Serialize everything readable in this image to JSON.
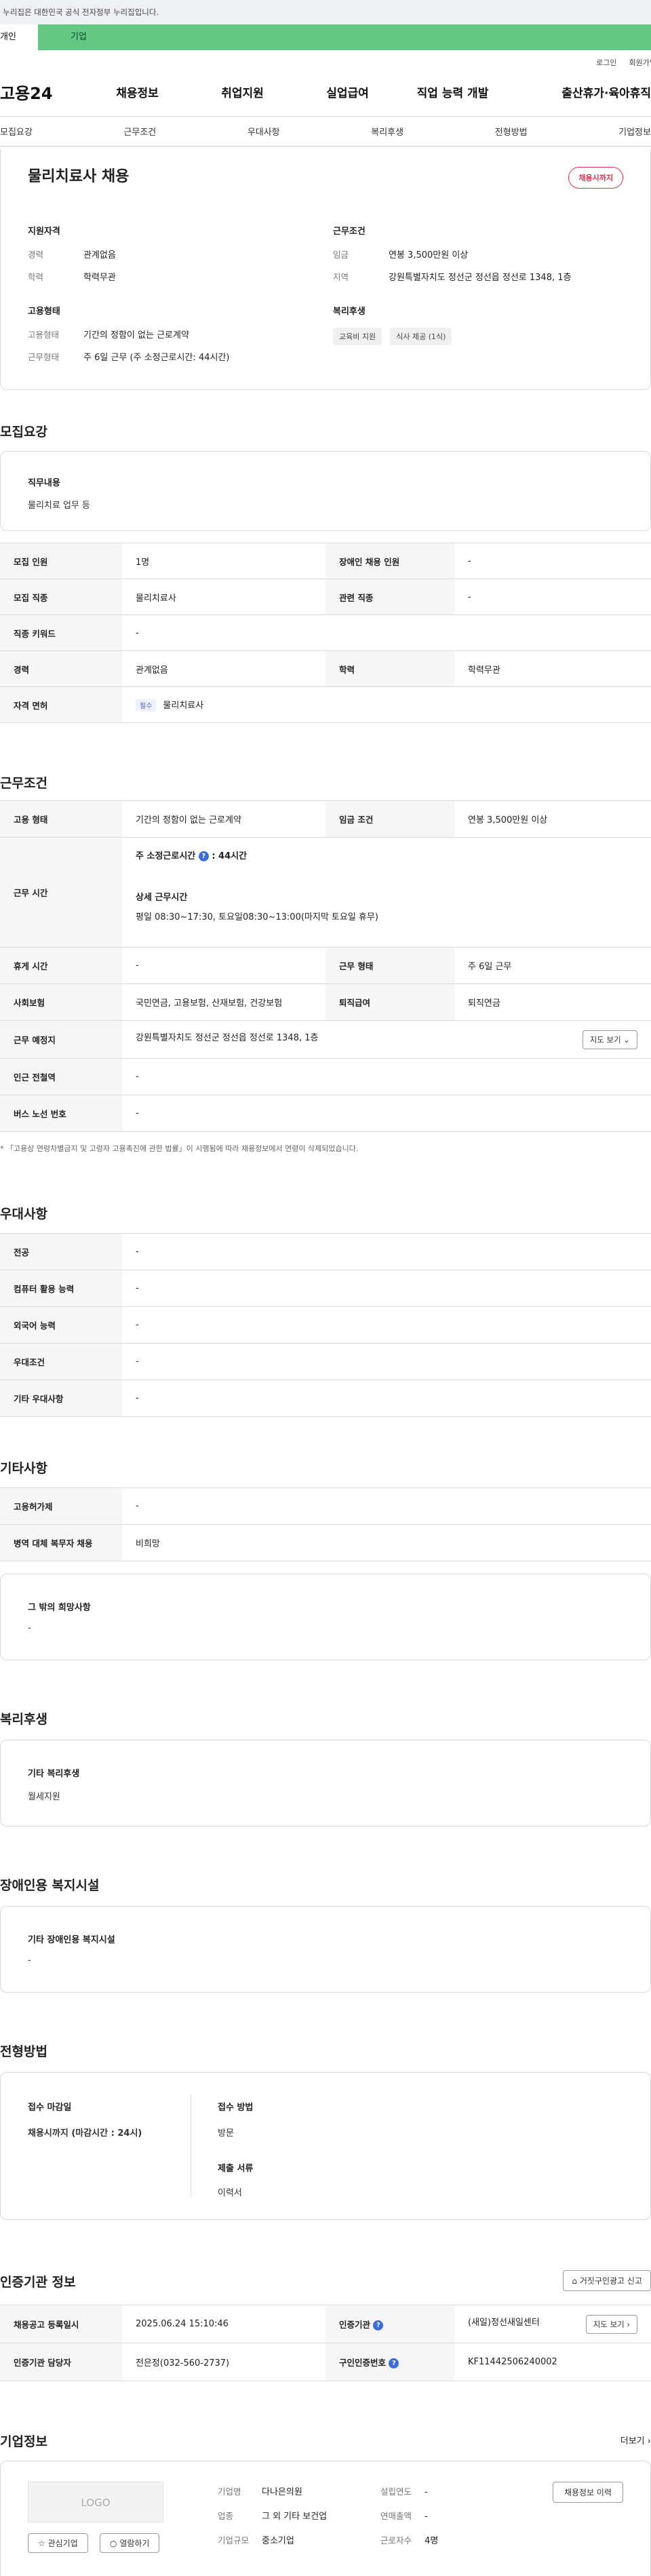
{
  "banner": {
    "text": "이 누리집은 대한민국 공식 전자정부 누리집입니다."
  },
  "tabs": [
    {
      "label": "개인"
    },
    {
      "label": "기업"
    }
  ],
  "toplinks": {
    "login": "로그인",
    "join": "회원가입"
  },
  "gnb": {
    "logo": "고용24",
    "items": [
      "채용정보",
      "취업지원",
      "실업급여",
      "직업 능력 개발",
      "출산휴가·육아휴직"
    ]
  },
  "subnav": [
    "모집요강",
    "근무조건",
    "우대사항",
    "복리후생",
    "전형방법",
    "기업정보"
  ],
  "hero": {
    "title": "물리치료사 채용",
    "status": "채용시까지",
    "qual": {
      "title": "지원자격",
      "rows": [
        {
          "k": "경력",
          "v": "관계없음"
        },
        {
          "k": "학력",
          "v": "학력무관"
        }
      ]
    },
    "cond": {
      "title": "근무조건",
      "rows": [
        {
          "k": "임금",
          "v": "연봉 3,500만원 이상"
        },
        {
          "k": "지역",
          "v": "강원특별자치도 정선군 정선읍 정선로 1348, 1층"
        }
      ]
    },
    "emp": {
      "title": "고용형태",
      "rows": [
        {
          "k": "고용형태",
          "v": "기간의 정함이 없는 근로계약"
        },
        {
          "k": "근무형태",
          "v": "주 6일 근무 (주 소정근로시간: 44시간)"
        }
      ]
    },
    "welfare": {
      "title": "복리후생",
      "chips": [
        "교육비 지원",
        "식사 제공 (1식)"
      ]
    }
  },
  "recruit": {
    "title": "모집요강",
    "duty_label": "직무내용",
    "duty_value": "물리치료 업무 등",
    "rows": {
      "count_h": "모집 인원",
      "count_v": "1명",
      "disabled_h": "장애인 채용 인원",
      "disabled_v": "-",
      "job_h": "모집 직종",
      "job_v": "물리치료사",
      "related_h": "관련 직종",
      "related_v": "-",
      "kw_h": "직종 키워드",
      "kw_v": "-",
      "career_h": "경력",
      "career_v": "관계없음",
      "edu_h": "학력",
      "edu_v": "학력무관",
      "license_h": "자격 면허",
      "license_tag": "필수",
      "license_v": "물리치료사"
    }
  },
  "work": {
    "title": "근무조건",
    "type_h": "고용 형태",
    "type_v": "기간의 정함이 없는 근로계약",
    "wage_h": "임금 조건",
    "wage_v": "연봉 3,500만원 이상",
    "time_h": "근무 시간",
    "time_week_label": "주 소정근로시간",
    "time_week_value": ": 44시간",
    "time_detail_label": "상세 근무시간",
    "time_detail_value": "평일 08:30~17:30, 토요일08:30~13:00(마지막 토요일 휴무)",
    "rest_h": "휴게 시간",
    "rest_v": "-",
    "form_h": "근무 형태",
    "form_v": "주 6일 근무",
    "ins_h": "사회보험",
    "ins_v": "국민연금, 고용보험, 산재보험, 건강보험",
    "sev_h": "퇴직급여",
    "sev_v": "퇴직연금",
    "place_h": "근무 예정지",
    "place_v": "강원특별자치도 정선군 정선읍 정선로 1348, 1층",
    "map_btn": "지도 보기",
    "subway_h": "인근 전철역",
    "subway_v": "-",
    "bus_h": "버스 노선 번호",
    "bus_v": "-",
    "note": "* 「고용상 연령차별금지 및 고령자 고용촉진에 관한 법률」이 시행됨에 따라 채용정보에서 연령이 삭제되었습니다."
  },
  "pref": {
    "title": "우대사항",
    "rows": [
      {
        "h": "전공",
        "v": "-"
      },
      {
        "h": "컴퓨터 활용 능력",
        "v": "-"
      },
      {
        "h": "외국어 능력",
        "v": "-"
      },
      {
        "h": "우대조건",
        "v": "-"
      },
      {
        "h": "기타 우대사항",
        "v": "-"
      }
    ]
  },
  "etc": {
    "title": "기타사항",
    "rows": [
      {
        "h": "고용허가제",
        "v": "-"
      },
      {
        "h": "병역 대체 복무자 채용",
        "v": "비희망"
      }
    ],
    "other_label": "그 밖의 희망사항",
    "other_value": "-"
  },
  "benefit": {
    "title": "복리후생",
    "label": "기타 복리후생",
    "value": "월세지원"
  },
  "disab": {
    "title": "장애인용 복지시설",
    "label": "기타 장애인용 복지시설",
    "value": "-"
  },
  "screen": {
    "title": "전형방법",
    "deadline_label": "접수 마감일",
    "deadline_value": "채용시까지 (마감시간 : 24시)",
    "method_label": "접수 방법",
    "method_value": "방문",
    "docs_label": "제출 서류",
    "docs_value": "이력서"
  },
  "cert": {
    "title": "인증기관 정보",
    "report_btn": "거짓구인광고 신고",
    "reg_h": "채용공고 등록일시",
    "reg_v": "2025.06.24 15:10:46",
    "org_h": "인증기관",
    "org_v": "(새일)정선새일센터",
    "map_btn": "지도 보기",
    "mgr_h": "인증기관 담당자",
    "mgr_v": "전은정(032-560-2737)",
    "no_h": "구인인증번호",
    "no_v": "KF11442506240002"
  },
  "company": {
    "title": "기업정보",
    "more": "더보기",
    "logo": "LOGO",
    "fav_btn": "관심기업",
    "view_btn": "열람하기",
    "jobs_btn": "채용정보 이력",
    "rows": [
      {
        "k": "기업명",
        "v": "다나은의원",
        "k2": "설립연도",
        "v2": "-"
      },
      {
        "k": "업종",
        "v": "그 외 기타 보건업",
        "k2": "연매출액",
        "v2": "-"
      },
      {
        "k": "기업규모",
        "v": "중소기업",
        "k2": "근로자수",
        "v2": "4명"
      }
    ]
  }
}
